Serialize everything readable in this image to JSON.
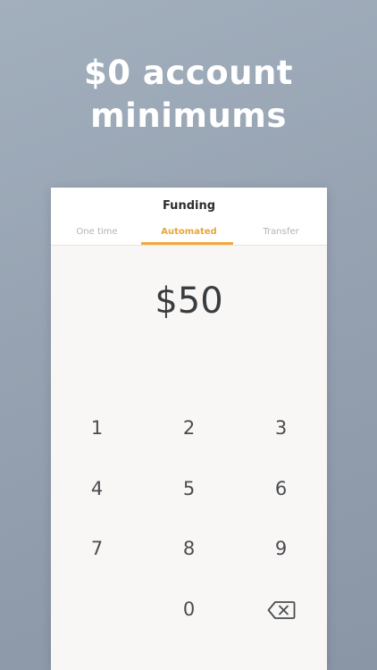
{
  "headline": {
    "line1": "$0 account",
    "line2": "minimums"
  },
  "card": {
    "title": "Funding",
    "tabs": [
      {
        "label": "One time",
        "active": false
      },
      {
        "label": "Automated",
        "active": true
      },
      {
        "label": "Transfer",
        "active": false
      }
    ],
    "amount": "$50",
    "keypad": {
      "keys": [
        "1",
        "2",
        "3",
        "4",
        "5",
        "6",
        "7",
        "8",
        "9",
        "0"
      ],
      "backspace_icon": "backspace-icon"
    }
  },
  "colors": {
    "accent": "#efaa3a",
    "background": "#96a2b1",
    "card": "#f8f7f5",
    "text": "#3a3d40"
  }
}
